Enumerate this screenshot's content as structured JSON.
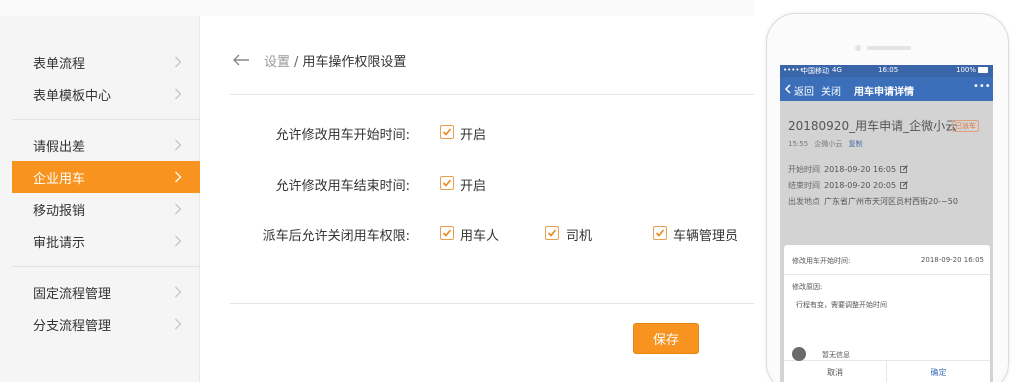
{
  "sidebar": {
    "items": [
      {
        "label": "表单流程"
      },
      {
        "label": "表单模板中心"
      },
      {
        "label": "请假出差"
      },
      {
        "label": "企业用车",
        "active": true
      },
      {
        "label": "移动报销"
      },
      {
        "label": "审批请示"
      },
      {
        "label": "固定流程管理"
      },
      {
        "label": "分支流程管理"
      }
    ]
  },
  "breadcrumb": {
    "parent": "设置",
    "separator": "/",
    "current": "用车操作权限设置"
  },
  "settings": {
    "row1": {
      "label": "允许修改用车开始时间:",
      "option": "开启",
      "checked": true
    },
    "row2": {
      "label": "允许修改用车结束时间:",
      "option": "开启",
      "checked": true
    },
    "row3": {
      "label": "派车后允许关闭用车权限:",
      "options": [
        {
          "label": "用车人",
          "checked": true
        },
        {
          "label": "司机",
          "checked": true
        },
        {
          "label": "车辆管理员",
          "checked": true
        }
      ]
    },
    "save_label": "保存"
  },
  "phone": {
    "status": {
      "carrier": "中国移动",
      "network": "4G",
      "time": "16:05",
      "battery": "100%"
    },
    "nav": {
      "back": "返回",
      "close": "关闭",
      "title": "用车申请详情",
      "more": "•••"
    },
    "request": {
      "title": "20180920_用车申请_企微小云",
      "tag": "已派车",
      "time": "15:55",
      "user": "企微小云",
      "copy": "复制",
      "start_label": "开始时间",
      "start_value": "2018-09-20 16:05",
      "end_label": "结束时间",
      "end_value": "2018-09-20 20:05",
      "place_label": "出发地点",
      "place_value": "广东省广州市天河区员村西街20-~50"
    },
    "dialog": {
      "field_label": "修改用车开始时间:",
      "field_value": "2018-09-20 16:05",
      "reason_label": "修改原因:",
      "reason_text": "行程有变，需要调整开始时间",
      "cancel": "取消",
      "confirm": "确定"
    },
    "footer": {
      "no_info": "暂无信息"
    }
  },
  "colors": {
    "accent": "#f7931e",
    "phone_nav": "#3c6fba",
    "link": "#3c6fba"
  }
}
